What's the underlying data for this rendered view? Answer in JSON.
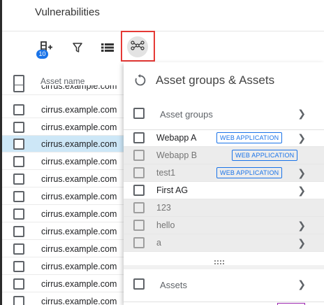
{
  "page": {
    "title": "Vulnerabilities"
  },
  "toolbar": {
    "columns_badge": "10",
    "items": [
      {
        "name": "columns-icon"
      },
      {
        "name": "filter-icon"
      },
      {
        "name": "list-view-icon"
      },
      {
        "name": "asset-graph-icon",
        "active": true
      }
    ]
  },
  "table": {
    "column_header": "Asset name",
    "rows": [
      {
        "asset": "cirrus.example.com",
        "selected": false
      },
      {
        "asset": "cirrus.example.com",
        "selected": false
      },
      {
        "asset": "cirrus.example.com",
        "selected": true
      },
      {
        "asset": "cirrus.example.com",
        "selected": false
      },
      {
        "asset": "cirrus.example.com",
        "selected": false
      },
      {
        "asset": "cirrus.example.com",
        "selected": false
      },
      {
        "asset": "cirrus.example.com",
        "selected": false
      },
      {
        "asset": "cirrus.example.com",
        "selected": false
      },
      {
        "asset": "cirrus.example.com",
        "selected": false
      },
      {
        "asset": "cirrus.example.com",
        "selected": false
      },
      {
        "asset": "cirrus.example.com",
        "selected": false
      },
      {
        "asset": "cirrus.example.com",
        "selected": false
      }
    ]
  },
  "panel": {
    "title": "Asset groups & Assets",
    "groups_label": "Asset groups",
    "assets_label": "Assets",
    "groups": [
      {
        "name": "Webapp A",
        "tag": "WEB APPLICATION",
        "muted": false,
        "chevron": true
      },
      {
        "name": "Webapp B",
        "tag": "WEB APPLICATION",
        "muted": true,
        "chevron": false
      },
      {
        "name": "test1",
        "tag": "WEB APPLICATION",
        "muted": true,
        "chevron": true
      },
      {
        "name": "First AG",
        "tag": "",
        "muted": false,
        "chevron": true
      },
      {
        "name": "123",
        "tag": "",
        "muted": true,
        "chevron": false
      },
      {
        "name": "hello",
        "tag": "",
        "muted": true,
        "chevron": true
      },
      {
        "name": "a",
        "tag": "",
        "muted": true,
        "chevron": true
      }
    ]
  },
  "colors": {
    "accent": "#1a73e8",
    "highlight": "#e53935",
    "selected_row": "#cde7f7"
  }
}
